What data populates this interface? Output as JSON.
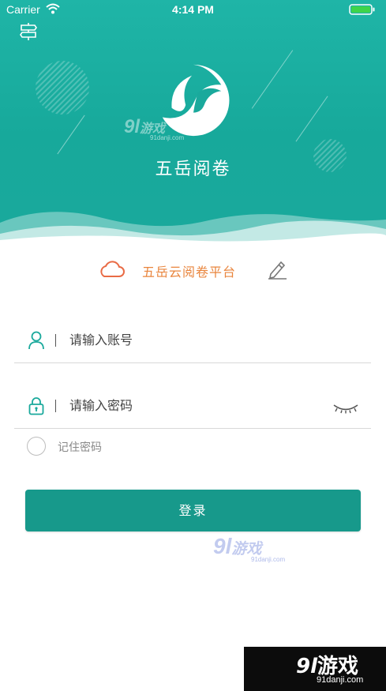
{
  "status_bar": {
    "carrier": "Carrier",
    "time": "4:14 PM"
  },
  "header": {
    "app_title": "五岳阅卷",
    "logo_icon": "wave-logo-icon",
    "settings_icon": "signpost-icon"
  },
  "platform": {
    "name": "五岳云阅卷平台",
    "cloud_icon": "cloud-icon",
    "edit_icon": "pencil-icon"
  },
  "form": {
    "account": {
      "placeholder": "请输入账号",
      "value": "",
      "icon": "user-icon"
    },
    "password": {
      "placeholder": "请输入密码",
      "value": "",
      "icon": "lock-icon",
      "toggle_icon": "eye-closed-icon"
    },
    "remember_label": "记住密码",
    "remember_checked": false,
    "login_label": "登录"
  },
  "watermarks": {
    "brand_num": "9l",
    "brand_cn": "游戏",
    "domain": "91danji.com"
  },
  "colors": {
    "primary": "#17998b",
    "header": "#1cb1a3",
    "platform_text": "#e9853d",
    "cloud": "#e96b45"
  }
}
